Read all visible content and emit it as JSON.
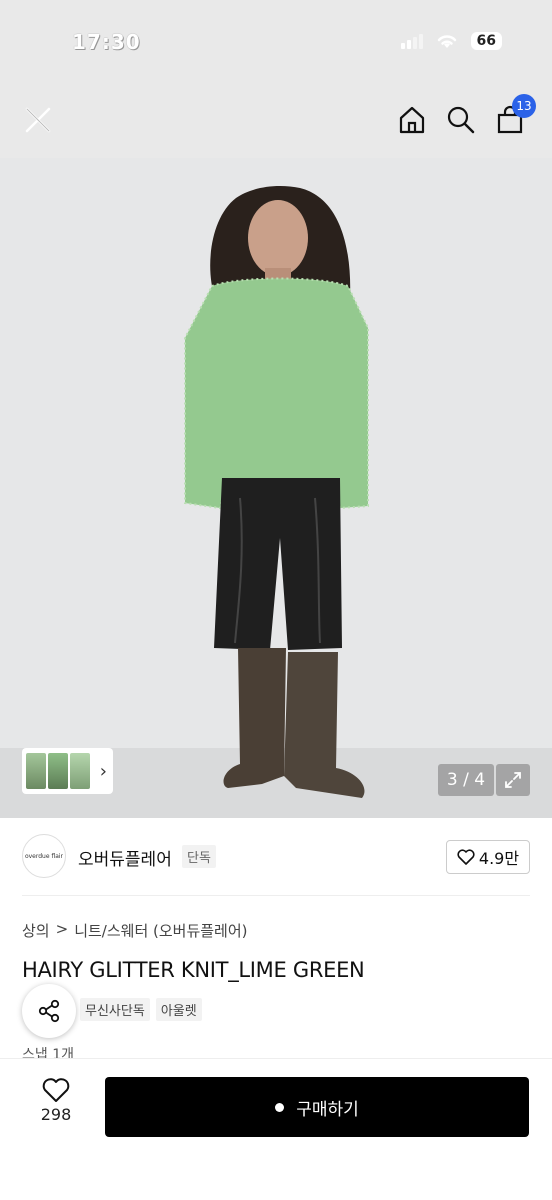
{
  "status_bar": {
    "time": "17:30",
    "battery": "66"
  },
  "nav": {
    "cart_count": "13"
  },
  "gallery": {
    "counter": "3 / 4"
  },
  "brand": {
    "logo_text": "overdue flair",
    "name": "오버듀플레어",
    "tag": "단독",
    "likes": "4.9만"
  },
  "breadcrumb": {
    "category": "상의",
    "separator": ">",
    "subcategory": "니트/스웨터 (오버듀플레어)"
  },
  "product": {
    "title": "HAIRY GLITTER KNIT_LIME GREEN",
    "tags": [
      "무신사단독",
      "아울렛"
    ],
    "snap": "스냅 1개"
  },
  "bottom_bar": {
    "wish_count": "298",
    "buy_label": "구매하기"
  },
  "colors": {
    "accent": "#2b62e8",
    "sweater": "#94c98f",
    "pants": "#1f1f1f",
    "boots": "#4a3f35",
    "background": "#e6e7e8"
  }
}
